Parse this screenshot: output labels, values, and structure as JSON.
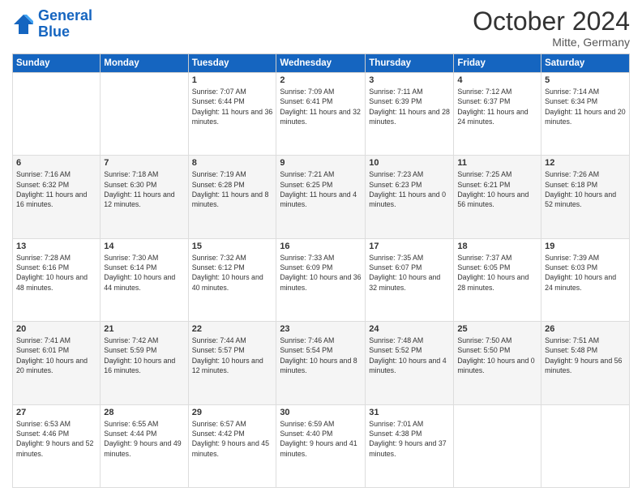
{
  "logo": {
    "line1": "General",
    "line2": "Blue"
  },
  "header": {
    "month": "October 2024",
    "location": "Mitte, Germany"
  },
  "weekdays": [
    "Sunday",
    "Monday",
    "Tuesday",
    "Wednesday",
    "Thursday",
    "Friday",
    "Saturday"
  ],
  "weeks": [
    [
      {
        "day": "",
        "sunrise": "",
        "sunset": "",
        "daylight": ""
      },
      {
        "day": "",
        "sunrise": "",
        "sunset": "",
        "daylight": ""
      },
      {
        "day": "1",
        "sunrise": "Sunrise: 7:07 AM",
        "sunset": "Sunset: 6:44 PM",
        "daylight": "Daylight: 11 hours and 36 minutes."
      },
      {
        "day": "2",
        "sunrise": "Sunrise: 7:09 AM",
        "sunset": "Sunset: 6:41 PM",
        "daylight": "Daylight: 11 hours and 32 minutes."
      },
      {
        "day": "3",
        "sunrise": "Sunrise: 7:11 AM",
        "sunset": "Sunset: 6:39 PM",
        "daylight": "Daylight: 11 hours and 28 minutes."
      },
      {
        "day": "4",
        "sunrise": "Sunrise: 7:12 AM",
        "sunset": "Sunset: 6:37 PM",
        "daylight": "Daylight: 11 hours and 24 minutes."
      },
      {
        "day": "5",
        "sunrise": "Sunrise: 7:14 AM",
        "sunset": "Sunset: 6:34 PM",
        "daylight": "Daylight: 11 hours and 20 minutes."
      }
    ],
    [
      {
        "day": "6",
        "sunrise": "Sunrise: 7:16 AM",
        "sunset": "Sunset: 6:32 PM",
        "daylight": "Daylight: 11 hours and 16 minutes."
      },
      {
        "day": "7",
        "sunrise": "Sunrise: 7:18 AM",
        "sunset": "Sunset: 6:30 PM",
        "daylight": "Daylight: 11 hours and 12 minutes."
      },
      {
        "day": "8",
        "sunrise": "Sunrise: 7:19 AM",
        "sunset": "Sunset: 6:28 PM",
        "daylight": "Daylight: 11 hours and 8 minutes."
      },
      {
        "day": "9",
        "sunrise": "Sunrise: 7:21 AM",
        "sunset": "Sunset: 6:25 PM",
        "daylight": "Daylight: 11 hours and 4 minutes."
      },
      {
        "day": "10",
        "sunrise": "Sunrise: 7:23 AM",
        "sunset": "Sunset: 6:23 PM",
        "daylight": "Daylight: 11 hours and 0 minutes."
      },
      {
        "day": "11",
        "sunrise": "Sunrise: 7:25 AM",
        "sunset": "Sunset: 6:21 PM",
        "daylight": "Daylight: 10 hours and 56 minutes."
      },
      {
        "day": "12",
        "sunrise": "Sunrise: 7:26 AM",
        "sunset": "Sunset: 6:18 PM",
        "daylight": "Daylight: 10 hours and 52 minutes."
      }
    ],
    [
      {
        "day": "13",
        "sunrise": "Sunrise: 7:28 AM",
        "sunset": "Sunset: 6:16 PM",
        "daylight": "Daylight: 10 hours and 48 minutes."
      },
      {
        "day": "14",
        "sunrise": "Sunrise: 7:30 AM",
        "sunset": "Sunset: 6:14 PM",
        "daylight": "Daylight: 10 hours and 44 minutes."
      },
      {
        "day": "15",
        "sunrise": "Sunrise: 7:32 AM",
        "sunset": "Sunset: 6:12 PM",
        "daylight": "Daylight: 10 hours and 40 minutes."
      },
      {
        "day": "16",
        "sunrise": "Sunrise: 7:33 AM",
        "sunset": "Sunset: 6:09 PM",
        "daylight": "Daylight: 10 hours and 36 minutes."
      },
      {
        "day": "17",
        "sunrise": "Sunrise: 7:35 AM",
        "sunset": "Sunset: 6:07 PM",
        "daylight": "Daylight: 10 hours and 32 minutes."
      },
      {
        "day": "18",
        "sunrise": "Sunrise: 7:37 AM",
        "sunset": "Sunset: 6:05 PM",
        "daylight": "Daylight: 10 hours and 28 minutes."
      },
      {
        "day": "19",
        "sunrise": "Sunrise: 7:39 AM",
        "sunset": "Sunset: 6:03 PM",
        "daylight": "Daylight: 10 hours and 24 minutes."
      }
    ],
    [
      {
        "day": "20",
        "sunrise": "Sunrise: 7:41 AM",
        "sunset": "Sunset: 6:01 PM",
        "daylight": "Daylight: 10 hours and 20 minutes."
      },
      {
        "day": "21",
        "sunrise": "Sunrise: 7:42 AM",
        "sunset": "Sunset: 5:59 PM",
        "daylight": "Daylight: 10 hours and 16 minutes."
      },
      {
        "day": "22",
        "sunrise": "Sunrise: 7:44 AM",
        "sunset": "Sunset: 5:57 PM",
        "daylight": "Daylight: 10 hours and 12 minutes."
      },
      {
        "day": "23",
        "sunrise": "Sunrise: 7:46 AM",
        "sunset": "Sunset: 5:54 PM",
        "daylight": "Daylight: 10 hours and 8 minutes."
      },
      {
        "day": "24",
        "sunrise": "Sunrise: 7:48 AM",
        "sunset": "Sunset: 5:52 PM",
        "daylight": "Daylight: 10 hours and 4 minutes."
      },
      {
        "day": "25",
        "sunrise": "Sunrise: 7:50 AM",
        "sunset": "Sunset: 5:50 PM",
        "daylight": "Daylight: 10 hours and 0 minutes."
      },
      {
        "day": "26",
        "sunrise": "Sunrise: 7:51 AM",
        "sunset": "Sunset: 5:48 PM",
        "daylight": "Daylight: 9 hours and 56 minutes."
      }
    ],
    [
      {
        "day": "27",
        "sunrise": "Sunrise: 6:53 AM",
        "sunset": "Sunset: 4:46 PM",
        "daylight": "Daylight: 9 hours and 52 minutes."
      },
      {
        "day": "28",
        "sunrise": "Sunrise: 6:55 AM",
        "sunset": "Sunset: 4:44 PM",
        "daylight": "Daylight: 9 hours and 49 minutes."
      },
      {
        "day": "29",
        "sunrise": "Sunrise: 6:57 AM",
        "sunset": "Sunset: 4:42 PM",
        "daylight": "Daylight: 9 hours and 45 minutes."
      },
      {
        "day": "30",
        "sunrise": "Sunrise: 6:59 AM",
        "sunset": "Sunset: 4:40 PM",
        "daylight": "Daylight: 9 hours and 41 minutes."
      },
      {
        "day": "31",
        "sunrise": "Sunrise: 7:01 AM",
        "sunset": "Sunset: 4:38 PM",
        "daylight": "Daylight: 9 hours and 37 minutes."
      },
      {
        "day": "",
        "sunrise": "",
        "sunset": "",
        "daylight": ""
      },
      {
        "day": "",
        "sunrise": "",
        "sunset": "",
        "daylight": ""
      }
    ]
  ]
}
